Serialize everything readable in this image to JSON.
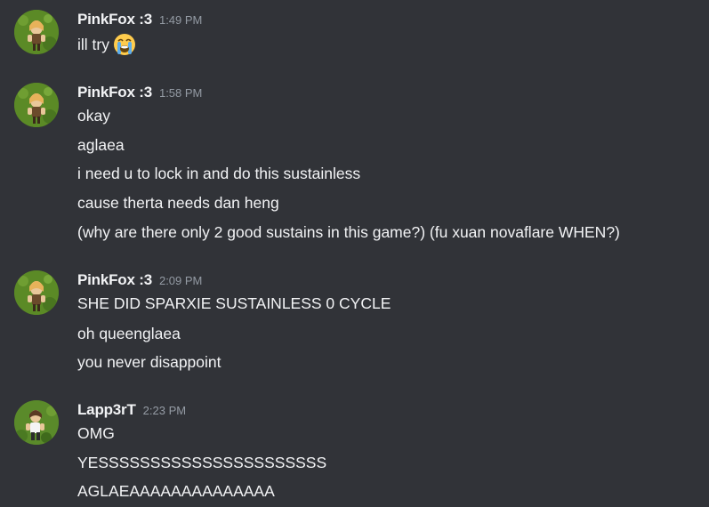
{
  "messages": [
    {
      "username": "PinkFox :3",
      "timestamp": "1:49 PM",
      "avatar_icon": "pinkfox-avatar-icon",
      "lines": [
        "ill try"
      ],
      "emoji": "loudly-crying-face-emoji"
    },
    {
      "username": "PinkFox :3",
      "timestamp": "1:58 PM",
      "avatar_icon": "pinkfox-avatar-icon",
      "lines": [
        "okay",
        "aglaea",
        "i need u to lock in and do this sustainless",
        "cause therta needs dan heng",
        "(why are there only 2 good sustains in this game?) (fu xuan novaflare WHEN?)"
      ]
    },
    {
      "username": "PinkFox :3",
      "timestamp": "2:09 PM",
      "avatar_icon": "pinkfox-avatar-icon",
      "lines": [
        "SHE DID SPARXIE SUSTAINLESS 0 CYCLE",
        "oh queenglaea",
        "you never disappoint"
      ]
    },
    {
      "username": "Lapp3rT",
      "timestamp": "2:23 PM",
      "avatar_icon": "lapp3rt-avatar-icon",
      "lines": [
        "OMG",
        "YESSSSSSSSSSSSSSSSSSSSSS",
        "AGLAEAAAAAAAAAAAAAA"
      ]
    }
  ],
  "colors": {
    "background": "#313338",
    "username": "#f2f3f5",
    "timestamp": "#949ba4",
    "message_text": "#f2f3f5"
  }
}
